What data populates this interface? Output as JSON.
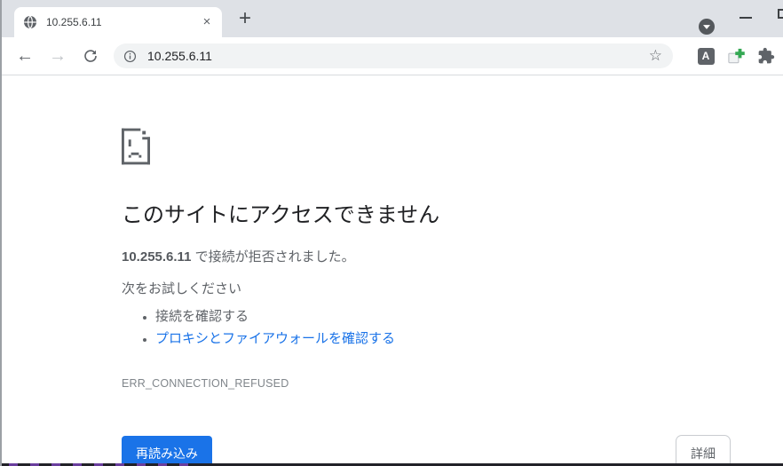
{
  "browser": {
    "tab": {
      "title": "10.255.6.11"
    },
    "omnibox": {
      "url": "10.255.6.11"
    },
    "extensions": {
      "a_badge": "A"
    }
  },
  "icons": {
    "close": "×",
    "new_tab": "+",
    "back": "←",
    "forward": "→",
    "star": "☆"
  },
  "error_page": {
    "title": "このサイトにアクセスできません",
    "message_host": "10.255.6.11",
    "message_rest": " で接続が拒否されました。",
    "suggestion_header": "次をお試しください",
    "suggestions": [
      {
        "text": "接続を確認する",
        "is_link": false
      },
      {
        "text": "プロキシとファイアウォールを確認する",
        "is_link": true
      }
    ],
    "error_code": "ERR_CONNECTION_REFUSED",
    "reload_button": "再読み込み",
    "details_button": "詳細"
  },
  "colors": {
    "accent_blue": "#1a73e8",
    "link_blue": "#1a73e8",
    "tabstrip_bg": "#dee1e6",
    "omnibox_bg": "#f1f3f4",
    "icon_gray": "#5f6368",
    "heading_text": "#202124",
    "body_text": "#5f6368",
    "error_code_text": "#80868b"
  }
}
